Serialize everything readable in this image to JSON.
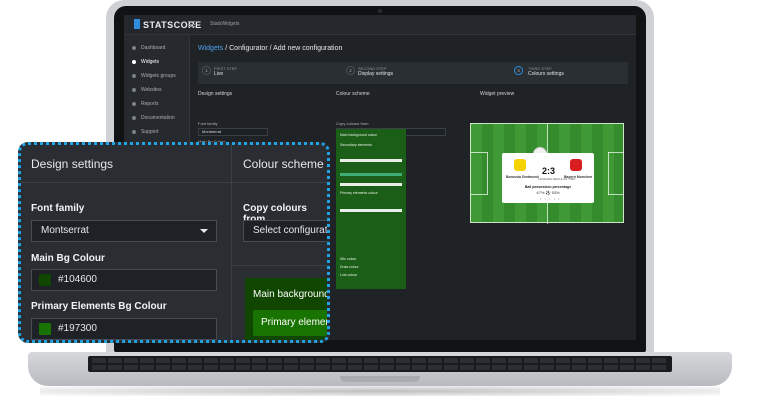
{
  "app": {
    "logo": "STATSCORE",
    "workspace": "StatsWidgets"
  },
  "sidebar": {
    "items": [
      {
        "label": "Dashboard",
        "active": false
      },
      {
        "label": "Widgets",
        "active": true
      },
      {
        "label": "Widgets groups",
        "active": false
      },
      {
        "label": "Websites",
        "active": false
      },
      {
        "label": "Reports",
        "active": false
      },
      {
        "label": "Documentation",
        "active": false
      },
      {
        "label": "Support",
        "active": false
      }
    ]
  },
  "breadcrumb": {
    "root": "Widgets",
    "rest": " / Configurator / Add new configuration"
  },
  "steps": [
    {
      "caption": "FIRST STEP",
      "title": "Live",
      "num": "1"
    },
    {
      "caption": "SECOND STEP",
      "title": "Display settings",
      "num": "2"
    },
    {
      "caption": "THIRD STEP",
      "title": "Colours settings",
      "num": "3"
    }
  ],
  "screen_panels": {
    "design_settings": "Design settings",
    "colour_scheme": "Colour scheme",
    "widget_preview": "Widget preview",
    "font_family_label": "Font family",
    "font_family_value": "Montserrat",
    "main_bg_label": "Main Bg Colour",
    "main_bg_value": "#104600",
    "copy_colours_label": "Copy colours from",
    "copy_colours_value": "Select configuration",
    "preview_size": "320",
    "green_labels": [
      "Main background colour",
      "Secondary elements",
      "Primary elements colour",
      "Win colour",
      "Draw colour",
      "Lost colour"
    ]
  },
  "widget": {
    "score": "2:3",
    "home_team": "Borussia Dortmund",
    "away_team": "Bayern Munchen",
    "status": "FINISHED REGULAR TIME",
    "stat_label": "Ball possession percentage",
    "stat_values": "47% ⚽ 53%",
    "dots": "• • • • •",
    "home_color": "#f6d200",
    "away_color": "#d81e1e"
  },
  "popup": {
    "design_settings": "Design settings",
    "colour_scheme": "Colour scheme",
    "font_family_label": "Font family",
    "font_family_value": "Montserrat",
    "main_bg_label": "Main Bg Colour",
    "main_bg_value": "#104600",
    "primary_bg_label": "Primary Elements Bg Colour",
    "primary_bg_value": "#197300",
    "copy_colours_label": "Copy colours from",
    "copy_colours_value": "Select configuration",
    "main_background_text": "Main background colour",
    "primary_elements_text": "Primary elements colour"
  },
  "colors": {
    "accent": "#21a3e6",
    "main_bg": "#104600",
    "primary_bg": "#197300"
  }
}
